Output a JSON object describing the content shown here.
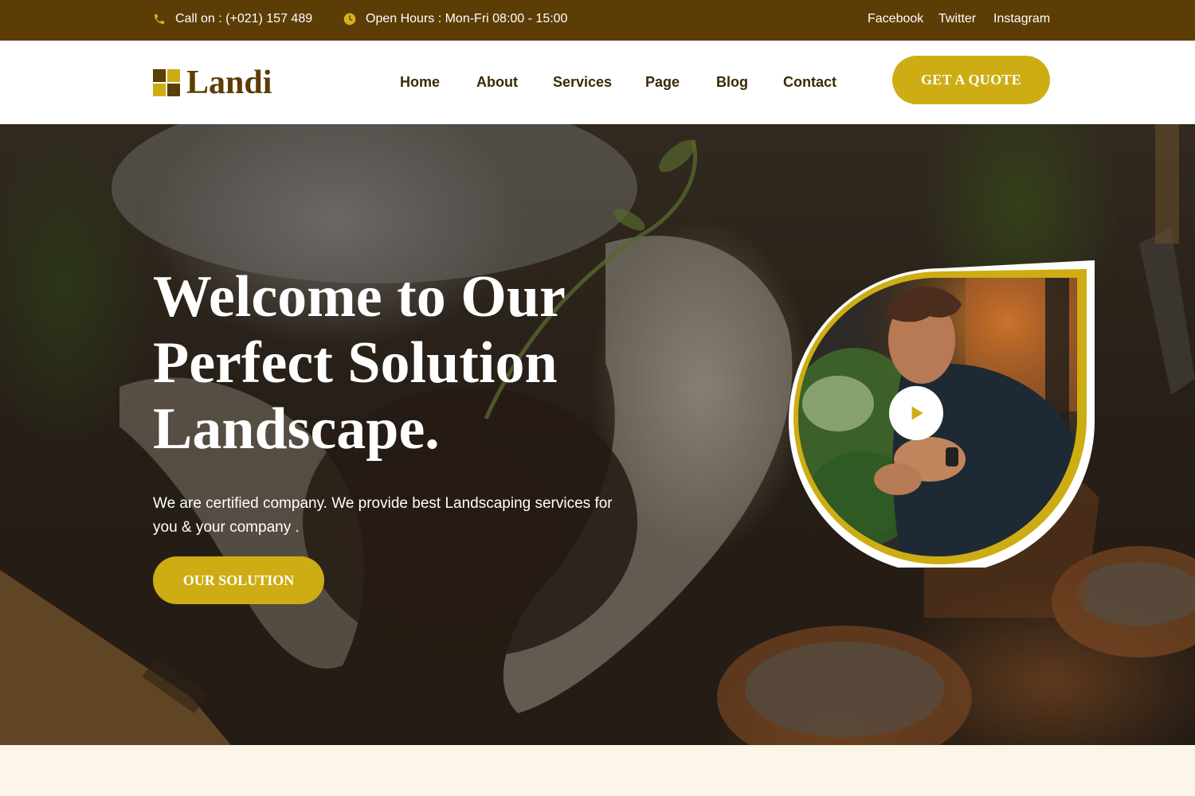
{
  "topbar": {
    "phone_text": "Call on : (+021) 157 489",
    "hours_text": "Open Hours : Mon-Fri 08:00 - 15:00",
    "phone_icon": "phone-icon",
    "clock_icon": "clock-icon",
    "social": [
      "Facebook",
      "Twitter",
      "Instagram"
    ]
  },
  "header": {
    "logo_text": "Landi",
    "nav": [
      "Home",
      "About",
      "Services",
      "Page",
      "Blog",
      "Contact"
    ],
    "cta_label": "GET A QUOTE"
  },
  "hero": {
    "title_lines": [
      "Welcome to Our",
      "Perfect Solution",
      "Landscape."
    ],
    "description": "We are certified company. We provide best Landscaping services for you & your company .",
    "button_label": "OUR SOLUTION",
    "play_icon": "play-icon"
  },
  "colors": {
    "brand_brown": "#5c3d05",
    "accent_gold": "#cdad13",
    "cream": "#fbf6e7"
  }
}
